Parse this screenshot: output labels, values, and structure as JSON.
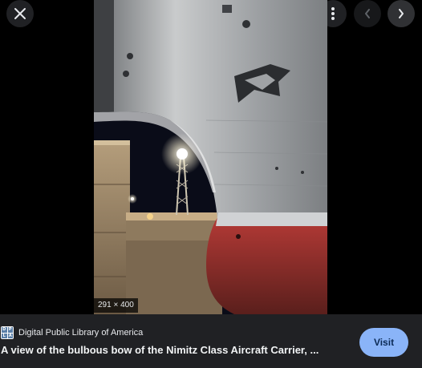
{
  "toolbar": {
    "close_icon": "close-icon",
    "lens_icon": "lens-icon",
    "more_icon": "more-vert-icon",
    "prev_icon": "chevron-left-icon",
    "next_icon": "chevron-right-icon"
  },
  "image": {
    "dimensions_label": "291 × 400"
  },
  "footer": {
    "source_name": "Digital Public Library of America",
    "favicon_letters": [
      "D",
      "P",
      "L",
      "A"
    ],
    "caption": "A view of the bulbous bow of the Nimitz Class Aircraft Carrier, ...",
    "visit_label": "Visit"
  },
  "colors": {
    "background": "#000000",
    "footer_bg": "#202124",
    "button_bg": "#303134",
    "visit_bg": "#8ab4f8"
  }
}
